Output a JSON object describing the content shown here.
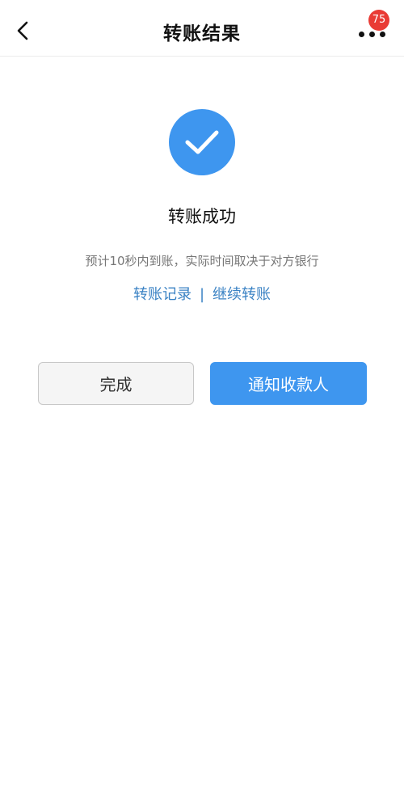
{
  "navbar": {
    "title": "转账结果",
    "badge_count": "75",
    "back_icon": "chevron-left-icon",
    "more_icon": "more-dots-icon"
  },
  "result": {
    "icon": "check-circle-icon",
    "icon_color": "#3e96ef",
    "title": "转账成功",
    "description": "预计10秒内到账，实际时间取决于对方银行"
  },
  "links": {
    "records": "转账记录",
    "separator": "|",
    "continue": "继续转账",
    "color": "#3a82c4"
  },
  "actions": {
    "done_label": "完成",
    "notify_label": "通知收款人",
    "primary_color": "#3e96ef"
  },
  "colors": {
    "badge": "#e93b35"
  }
}
